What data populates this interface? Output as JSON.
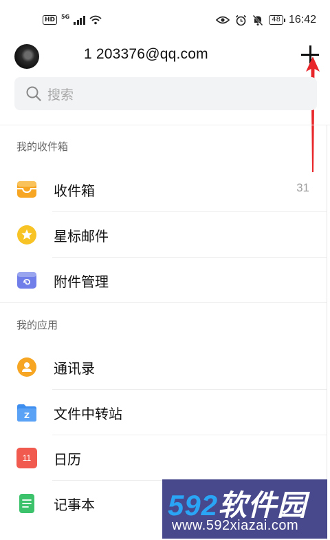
{
  "status_bar": {
    "hd": "HD",
    "network": "5G",
    "battery": "48",
    "time": "16:42"
  },
  "header": {
    "account": "1  203376@qq.com"
  },
  "search": {
    "placeholder": "搜索"
  },
  "sections": {
    "mailbox_title": "我的收件箱",
    "apps_title": "我的应用"
  },
  "mailbox_items": [
    {
      "label": "收件箱",
      "count": "31",
      "icon": "inbox-icon",
      "color": "#f6a623"
    },
    {
      "label": "星标邮件",
      "count": "",
      "icon": "star-icon",
      "color": "#f7c325"
    },
    {
      "label": "附件管理",
      "count": "",
      "icon": "attachment-icon",
      "color": "#6f7ee8"
    }
  ],
  "app_items": [
    {
      "label": "通讯录",
      "icon": "contacts-icon",
      "color": "#f6a623"
    },
    {
      "label": "文件中转站",
      "icon": "folder-icon",
      "color": "#3e8ef0"
    },
    {
      "label": "日历",
      "icon": "calendar-icon",
      "calendar_day": "11",
      "color": "#f05a4f"
    },
    {
      "label": "记事本",
      "icon": "notepad-icon",
      "color": "#3cc26b"
    }
  ],
  "watermark": {
    "title_num": "592",
    "title_text": "软件园",
    "url": "www.592xiazai.com"
  },
  "colors": {
    "annotation_arrow": "#e8262a",
    "search_bg": "#f2f3f5"
  }
}
